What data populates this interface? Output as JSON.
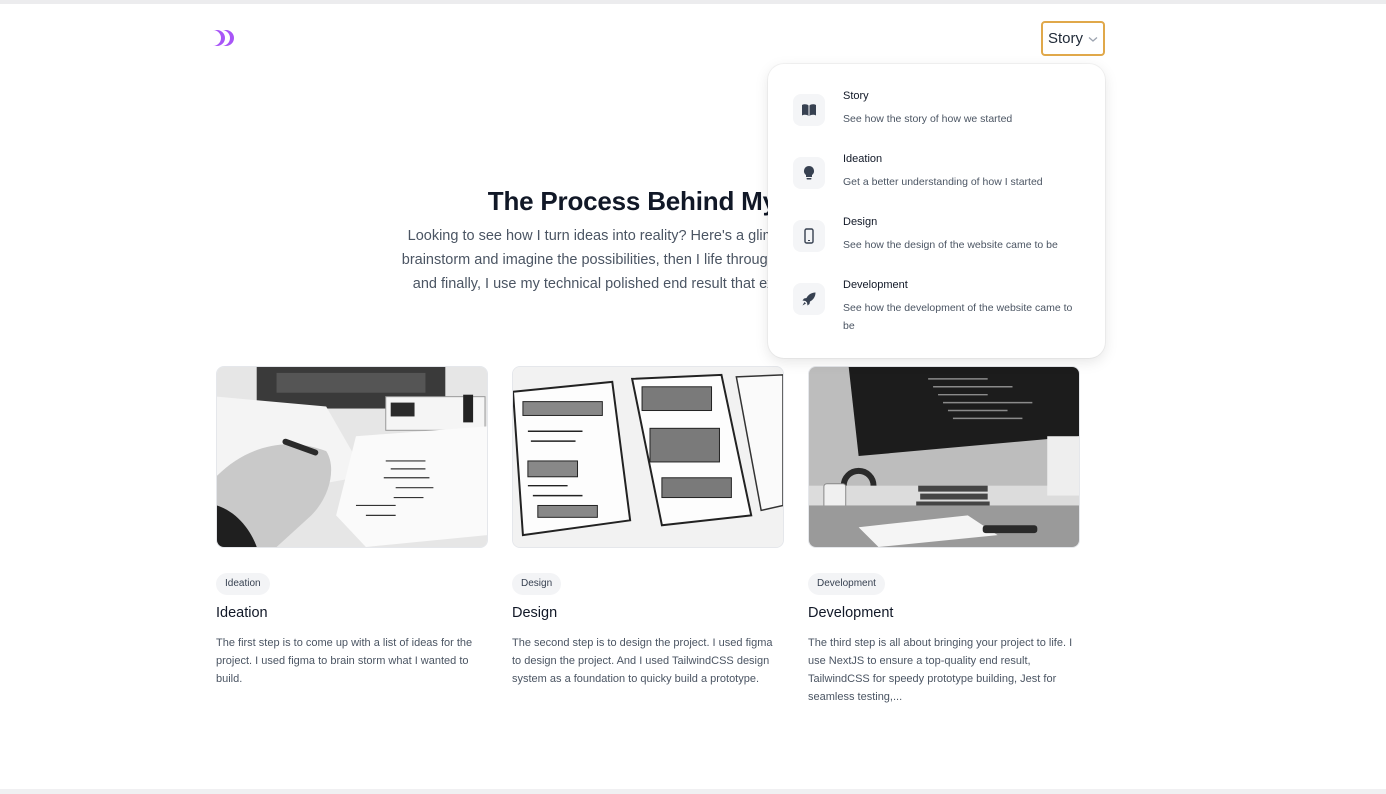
{
  "header": {
    "logo_icon": "double-chevron-logo",
    "brand_color": "#a855f7",
    "nav_button": {
      "label": "Story",
      "icon": "chevron-down-icon",
      "border_color": "#e0a84a"
    }
  },
  "hero": {
    "title": "The Process Behind My W",
    "text": "Looking to see how I turn ideas into reality? Here's a glimps process: first, I brainstorm and imagine the possibilities, then I life through thoughtful design, and finally, I use my technical polished end result that exceeds expectatio"
  },
  "cards": [
    {
      "tag": "Ideation",
      "title": "Ideation",
      "text": "The first step is to come up with a list of ideas for the project. I used figma to brain storm what I wanted to build.",
      "image": "photo-hand-writing-notes"
    },
    {
      "tag": "Design",
      "title": "Design",
      "text": "The second step is to design the project. I used figma to design the project. And I used TailwindCSS design system as a foundation to quicky build a prototype.",
      "image": "photo-wireframe-sketches"
    },
    {
      "tag": "Development",
      "title": "Development",
      "text": "The third step is all about bringing your project to life. I use NextJS to ensure a top-quality end result, TailwindCSS for speedy prototype building, Jest for seamless testing,...",
      "image": "photo-desk-monitor"
    }
  ],
  "dropdown": {
    "items": [
      {
        "title": "Story",
        "description": "See how the story of how we started",
        "icon": "book-icon"
      },
      {
        "title": "Ideation",
        "description": "Get a better understanding of how I started",
        "icon": "lightbulb-icon"
      },
      {
        "title": "Design",
        "description": "See how the design of the website came to be",
        "icon": "phone-icon"
      },
      {
        "title": "Development",
        "description": "See how the development of the website came to be",
        "icon": "rocket-icon"
      }
    ]
  }
}
